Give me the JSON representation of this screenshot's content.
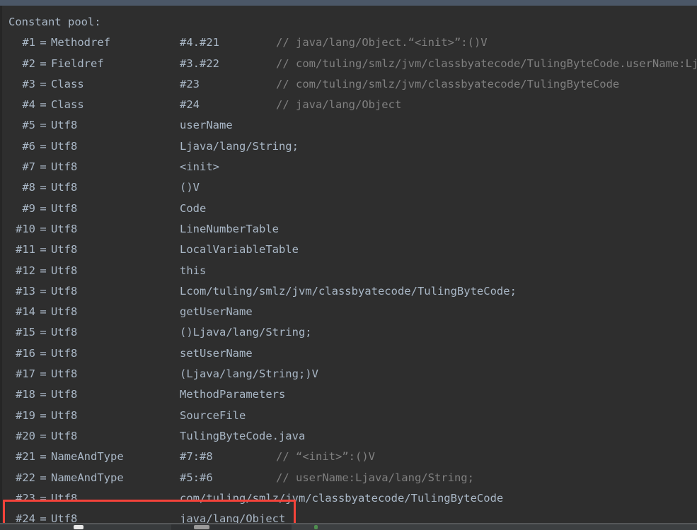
{
  "window": {
    "top_bar_color": "#4b5767",
    "console_bg": "#2e2e2e",
    "text_color": "#a9b7c6",
    "comment_color": "#808080",
    "annotation_color": "#f4433a"
  },
  "console": {
    "title": "Constant pool:"
  },
  "constant_pool": [
    {
      "index": "#1",
      "eq": "=",
      "tag": "Methodref",
      "value": "#4.#21",
      "comment": "// java/lang/Object.“<init>”:()V"
    },
    {
      "index": "#2",
      "eq": "=",
      "tag": "Fieldref",
      "value": "#3.#22",
      "comment": "// com/tuling/smlz/jvm/classbyatecode/TulingByteCode.userName:Ljava"
    },
    {
      "index": "#3",
      "eq": "=",
      "tag": "Class",
      "value": "#23",
      "comment": "// com/tuling/smlz/jvm/classbyatecode/TulingByteCode"
    },
    {
      "index": "#4",
      "eq": "=",
      "tag": "Class",
      "value": "#24",
      "comment": "// java/lang/Object"
    },
    {
      "index": "#5",
      "eq": "=",
      "tag": "Utf8",
      "value": "userName",
      "comment": ""
    },
    {
      "index": "#6",
      "eq": "=",
      "tag": "Utf8",
      "value": "Ljava/lang/String;",
      "comment": ""
    },
    {
      "index": "#7",
      "eq": "=",
      "tag": "Utf8",
      "value": "<init>",
      "comment": ""
    },
    {
      "index": "#8",
      "eq": "=",
      "tag": "Utf8",
      "value": "()V",
      "comment": ""
    },
    {
      "index": "#9",
      "eq": "=",
      "tag": "Utf8",
      "value": "Code",
      "comment": ""
    },
    {
      "index": "#10",
      "eq": "=",
      "tag": "Utf8",
      "value": "LineNumberTable",
      "comment": ""
    },
    {
      "index": "#11",
      "eq": "=",
      "tag": "Utf8",
      "value": "LocalVariableTable",
      "comment": ""
    },
    {
      "index": "#12",
      "eq": "=",
      "tag": "Utf8",
      "value": "this",
      "comment": ""
    },
    {
      "index": "#13",
      "eq": "=",
      "tag": "Utf8",
      "value": "Lcom/tuling/smlz/jvm/classbyatecode/TulingByteCode;",
      "comment": ""
    },
    {
      "index": "#14",
      "eq": "=",
      "tag": "Utf8",
      "value": "getUserName",
      "comment": ""
    },
    {
      "index": "#15",
      "eq": "=",
      "tag": "Utf8",
      "value": "()Ljava/lang/String;",
      "comment": ""
    },
    {
      "index": "#16",
      "eq": "=",
      "tag": "Utf8",
      "value": "setUserName",
      "comment": ""
    },
    {
      "index": "#17",
      "eq": "=",
      "tag": "Utf8",
      "value": "(Ljava/lang/String;)V",
      "comment": ""
    },
    {
      "index": "#18",
      "eq": "=",
      "tag": "Utf8",
      "value": "MethodParameters",
      "comment": ""
    },
    {
      "index": "#19",
      "eq": "=",
      "tag": "Utf8",
      "value": "SourceFile",
      "comment": ""
    },
    {
      "index": "#20",
      "eq": "=",
      "tag": "Utf8",
      "value": "TulingByteCode.java",
      "comment": ""
    },
    {
      "index": "#21",
      "eq": "=",
      "tag": "NameAndType",
      "value": "#7:#8",
      "comment": "// “<init>”:()V"
    },
    {
      "index": "#22",
      "eq": "=",
      "tag": "NameAndType",
      "value": "#5:#6",
      "comment": "// userName:Ljava/lang/String;"
    },
    {
      "index": "#23",
      "eq": "=",
      "tag": "Utf8",
      "value": "com/tuling/smlz/jvm/classbyatecode/TulingByteCode",
      "comment": ""
    },
    {
      "index": "#24",
      "eq": "=",
      "tag": "Utf8",
      "value": "java/lang/Object",
      "comment": ""
    }
  ],
  "annotation": {
    "highlighted_entry_index": "#24",
    "shape": "rectangle",
    "color": "#f4433a"
  }
}
